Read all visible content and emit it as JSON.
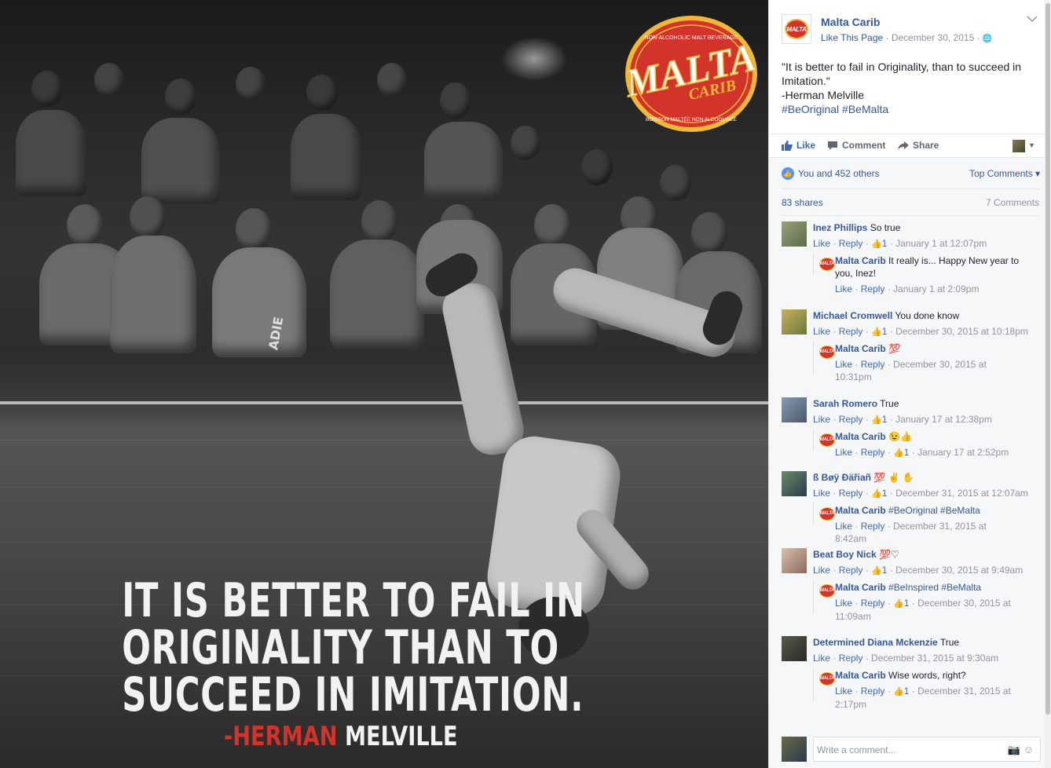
{
  "photo": {
    "logo_top_text": "NON-ALCOHOLIC MALT BEVERAGE",
    "logo_brand": "MALTA",
    "logo_sub": "CARIB",
    "logo_bottom_text": "BOISSON MALTÉE NON ALCOOLISÉE",
    "quote_lines": [
      "IT IS BETTER TO FAIL IN",
      "ORIGINALITY THAN TO",
      "SUCCEED IN IMITATION."
    ],
    "author_first": "-HERMAN",
    "author_last": "MELVILLE",
    "shirt_text": "ADIE"
  },
  "post": {
    "page_name": "Malta Carib",
    "like_page": "Like This Page",
    "dot": " · ",
    "date": "December 30, 2015",
    "dot2": " · ",
    "globe": "🌐",
    "text_line1": "\"It is better to fail in Originality, than to succeed in Imitation.\"",
    "text_line2": "-Herman Melville",
    "hashtags": "#BeOriginal #BeMalta",
    "actions": {
      "like": "Like",
      "comment": "Comment",
      "share": "Share"
    },
    "likes_text": "You and 452 others",
    "top_comments": "Top Comments ▾",
    "shares": "83 shares",
    "comments_count": "7 Comments",
    "write_placeholder": "Write a comment..."
  },
  "comments": [
    {
      "name": "Inez Phillips",
      "text": " So true",
      "meta_like": "Like",
      "meta_reply": "Reply",
      "likes": "1",
      "time": "January 1 at 12:07pm",
      "reply": {
        "name": "Malta Carib",
        "text": " It really is... Happy New year to you, Inez!",
        "meta_like": "Like",
        "meta_reply": "Reply",
        "likes": "",
        "time": "January 1 at 2:09pm"
      }
    },
    {
      "name": "Michael Cromwell",
      "text": " You done know",
      "meta_like": "Like",
      "meta_reply": "Reply",
      "likes": "1",
      "time": "December 30, 2015 at 10:18pm",
      "reply": {
        "name": "Malta Carib",
        "text": " 💯",
        "meta_like": "Like",
        "meta_reply": "Reply",
        "likes": "",
        "time": "December 30, 2015 at 10:31pm"
      }
    },
    {
      "name": "Sarah Romero",
      "text": " True",
      "meta_like": "Like",
      "meta_reply": "Reply",
      "likes": "1",
      "time": "January 17 at 12:38pm",
      "reply": {
        "name": "Malta Carib",
        "text": " 😉👍",
        "meta_like": "Like",
        "meta_reply": "Reply",
        "likes": "1",
        "time": "January 17 at 2:52pm"
      }
    },
    {
      "name": "ß Bøÿ Ðäřiañ",
      "text": " 💯 ✌ ✋",
      "meta_like": "Like",
      "meta_reply": "Reply",
      "likes": "1",
      "time": "December 31, 2015 at 12:07am",
      "reply": {
        "name": "Malta Carib",
        "text": " #BeOriginal #BeMalta",
        "meta_like": "Like",
        "meta_reply": "Reply",
        "likes": "",
        "time": "December 31, 2015 at 8:42am"
      }
    },
    {
      "name": "Beat Boy Nick",
      "text": " 💯♡",
      "meta_like": "Like",
      "meta_reply": "Reply",
      "likes": "1",
      "time": "December 30, 2015 at 9:49am",
      "reply": {
        "name": "Malta Carib",
        "text": " #BeInspired #BeMalta",
        "meta_like": "Like",
        "meta_reply": "Reply",
        "likes": "1",
        "time": "December 30, 2015 at 11:09am"
      }
    },
    {
      "name": "Determined Diana Mckenzie",
      "text": " True",
      "meta_like": "Like",
      "meta_reply": "Reply",
      "likes": "",
      "time": "December 31, 2015 at 9:30am",
      "reply": {
        "name": "Malta Carib",
        "text": " Wise words, right?",
        "meta_like": "Like",
        "meta_reply": "Reply",
        "likes": "1",
        "time": "December 31, 2015 at 2:17pm"
      }
    }
  ],
  "colors": {
    "fb_blue": "#365899",
    "link_blue": "#4267b2",
    "malta_red": "#d2332a",
    "malta_gold": "#f0b83a"
  }
}
